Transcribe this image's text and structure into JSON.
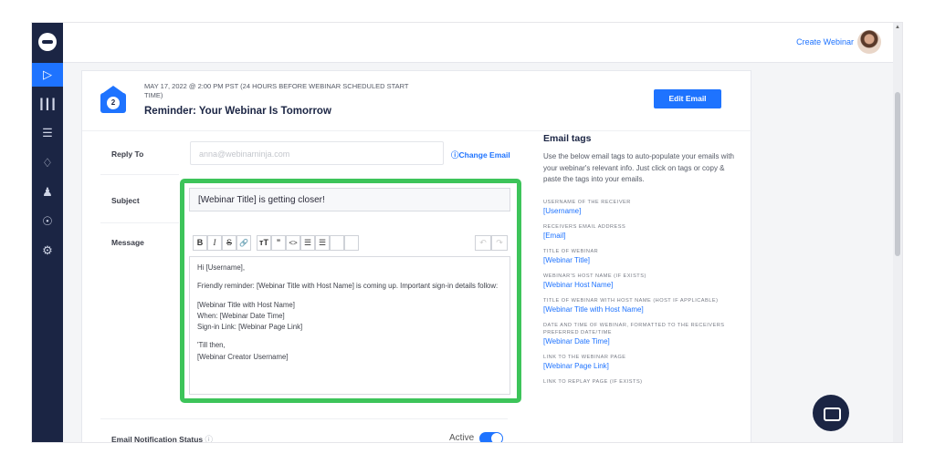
{
  "topbar": {
    "create_webinar": "Create Webinar"
  },
  "sidebar": {
    "items": [
      "play-icon",
      "analytics-icon",
      "list-icon",
      "integration-icon",
      "team-icon",
      "globe-icon",
      "settings-icon"
    ]
  },
  "email": {
    "schedule": "MAY 17, 2022 @ 2:00 PM PST (24 HOURS BEFORE WEBINAR SCHEDULED START TIME)",
    "number": "2",
    "title": "Reminder: Your Webinar Is Tomorrow",
    "edit_label": "Edit Email",
    "reply_label": "Reply To",
    "reply_placeholder": "anna@webinarninja.com",
    "change_email": "ⓘChange Email",
    "subject_label": "Subject",
    "subject_value": "[Webinar Title] is getting closer!",
    "message_label": "Message",
    "message_lines": [
      "Hi [Username],",
      "",
      "Friendly reminder: [Webinar Title with Host Name] is coming up. Important sign-in details follow:",
      "",
      "[Webinar Title with Host Name]",
      "When: [Webinar Date Time]",
      "Sign-in Link: [Webinar Page Link]",
      "",
      "'Till then,",
      "[Webinar Creator Username]"
    ],
    "status_label": "Email Notification Status",
    "status_value": "Active"
  },
  "toolbar": [
    "B",
    "I",
    "S",
    "🔗",
    "тT",
    "”",
    "<>",
    "☰",
    "☰"
  ],
  "tags": {
    "title": "Email tags",
    "description": "Use the below email tags to auto-populate your emails with your webinar's relevant info. Just click on tags or copy & paste the tags into your emails.",
    "items": [
      {
        "desc": "USERNAME OF THE RECEIVER",
        "tag": "[Username]"
      },
      {
        "desc": "RECEIVERS EMAIL ADDRESS",
        "tag": "[Email]"
      },
      {
        "desc": "TITLE OF WEBINAR",
        "tag": "[Webinar Title]"
      },
      {
        "desc": "WEBINAR'S HOST NAME (IF EXISTS)",
        "tag": "[Webinar Host Name]"
      },
      {
        "desc": "TITLE OF WEBINAR WITH HOST NAME (HOST IF APPLICABLE)",
        "tag": "[Webinar Title with Host Name]"
      },
      {
        "desc": "DATE AND TIME OF WEBINAR, FORMATTED TO THE RECEIVERS PREFERRED DATE/TIME",
        "tag": "[Webinar Date Time]"
      },
      {
        "desc": "LINK TO THE WEBINAR PAGE",
        "tag": "[Webinar Page Link]"
      },
      {
        "desc": "LINK TO REPLAY PAGE (IF EXISTS)",
        "tag": ""
      }
    ]
  },
  "colors": {
    "sidebar": "#1b2544",
    "accent": "#1e73ff",
    "highlight": "#3dc45a"
  }
}
